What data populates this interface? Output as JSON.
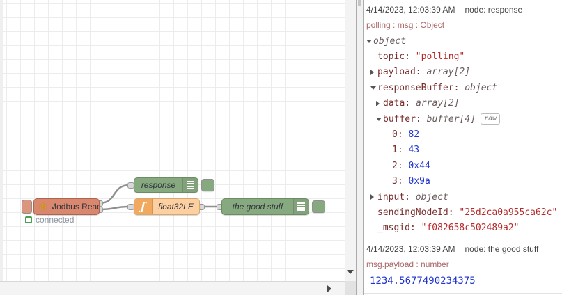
{
  "flow": {
    "modbus_node": {
      "label": "Modbus Read",
      "status_text": "connected"
    },
    "response_node": {
      "label": "response"
    },
    "function_node": {
      "label": "float32LE"
    },
    "good_node": {
      "label": "the good stuff"
    }
  },
  "icons": {
    "modbus_icon": "✻",
    "function_icon": "ƒ",
    "debug_sidebar_icon": "list-bars",
    "scroll_down_arrow": "triangle-down",
    "scroll_right_arrow": "triangle-right"
  },
  "colors": {
    "modbus_node": "#d9876e",
    "debug_node": "#87a980",
    "function_node": "#fdd0a2",
    "function_icon_bg": "#f0a95e",
    "wire": "#8f8f8f",
    "status_green": "#4a9e4f",
    "meta_text": "#aa6666",
    "key_text": "#792e2e",
    "string_value": "#b72828",
    "number_value": "#2033d0"
  },
  "debug": {
    "messages": [
      {
        "timestamp": "4/14/2023, 12:03:39 AM",
        "node_label": "node: response",
        "meta": "polling : msg : Object",
        "tree": [
          {
            "level": 0,
            "arrow": "down",
            "type": "object"
          },
          {
            "level": 1,
            "key": "topic",
            "value": "\"polling\"",
            "vtype": "string"
          },
          {
            "level": 1,
            "arrow": "right",
            "key": "payload",
            "type": "array[2]"
          },
          {
            "level": 1,
            "arrow": "down",
            "key": "responseBuffer",
            "type": "object"
          },
          {
            "level": 2,
            "arrow": "right",
            "key": "data",
            "type": "array[2]"
          },
          {
            "level": 2,
            "arrow": "down",
            "key": "buffer",
            "type": "buffer[4]",
            "badge": "raw"
          },
          {
            "level": 3,
            "key": "0",
            "value": "82",
            "vtype": "number"
          },
          {
            "level": 3,
            "key": "1",
            "value": "43",
            "vtype": "number"
          },
          {
            "level": 3,
            "key": "2",
            "value": "0x44",
            "vtype": "number"
          },
          {
            "level": 3,
            "key": "3",
            "value": "0x9a",
            "vtype": "number"
          },
          {
            "level": 1,
            "arrow": "right",
            "key": "input",
            "type": "object"
          },
          {
            "level": 1,
            "key": "sendingNodeId",
            "value": "\"25d2ca0a955ca62c\"",
            "vtype": "string"
          },
          {
            "level": 1,
            "key": "_msgid",
            "value": "\"f082658c502489a2\"",
            "vtype": "string"
          }
        ]
      },
      {
        "timestamp": "4/14/2023, 12:03:39 AM",
        "node_label": "node: the good stuff",
        "meta": "msg.payload : number",
        "payload": "1234.5677490234375"
      }
    ]
  }
}
